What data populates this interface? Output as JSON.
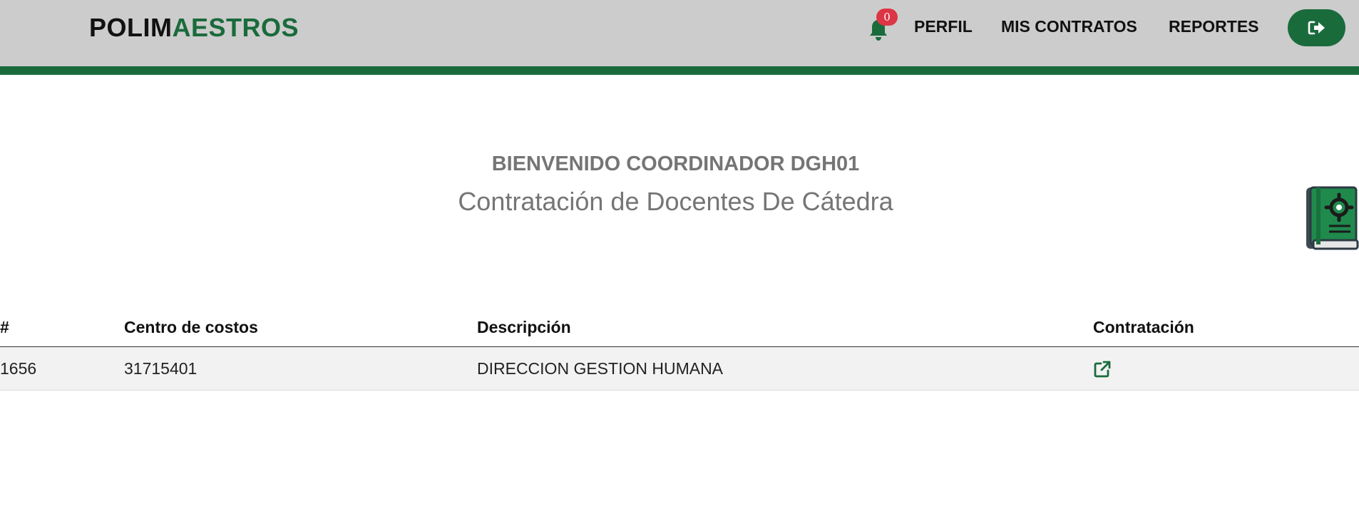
{
  "header": {
    "brand_part1": "POLIM",
    "brand_part2": "AESTROS",
    "notifications_count": "0",
    "nav": {
      "profile": "PERFIL",
      "contracts": "MIS CONTRATOS",
      "reports": "REPORTES"
    },
    "logout_icon": "sign-out-icon"
  },
  "main": {
    "welcome": "BIENVENIDO COORDINADOR DGH01",
    "subtitle": "Contratación de Docentes De Cátedra"
  },
  "table": {
    "headers": {
      "num": "#",
      "cost_center": "Centro de costos",
      "description": "Descripción",
      "hiring": "Contratación"
    },
    "rows": [
      {
        "num": "1656",
        "cost_center": "31715401",
        "description": "DIRECCION GESTION HUMANA",
        "hiring_icon": "external-link-icon"
      }
    ]
  },
  "colors": {
    "brand_green": "#1a6b3c",
    "navbar_bg": "#cccccc",
    "badge_red": "#dc3545",
    "muted_text": "#757575"
  }
}
